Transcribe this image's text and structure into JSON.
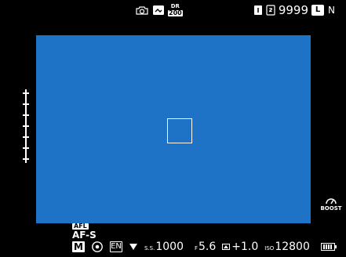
{
  "top_center": {
    "dr_top": "DR",
    "dr_bottom": "200"
  },
  "top_right": {
    "shots_remaining": "9999",
    "quality": "L",
    "suffix": "N"
  },
  "af": {
    "lock_label": "AFL",
    "mode_label": "AF-S"
  },
  "bottom": {
    "mode": "M",
    "metering_badge": "EN",
    "shutter_label": "S.S.",
    "shutter_value": "1000",
    "aperture_label": "F",
    "aperture_value": "5.6",
    "ev_value": "+1.0",
    "iso_label": "ISO",
    "iso_value": "12800"
  },
  "right": {
    "boost_label": "BOOST"
  }
}
